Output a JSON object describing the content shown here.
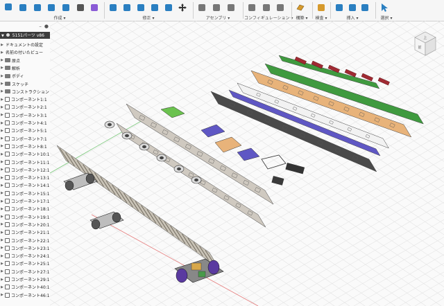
{
  "toolbar": {
    "groups": [
      {
        "label": "作成 ▾",
        "icons": [
          "new-sketch-icon",
          "extrude-icon",
          "box-icon",
          "sketch-rect-icon",
          "polygon-icon",
          "shell-icon"
        ]
      },
      {
        "label": "修正 ▾",
        "icons": [
          "press-pull-icon",
          "fillet-icon",
          "chamfer-icon",
          "split-icon",
          "align-icon",
          "move-icon"
        ]
      },
      {
        "label": "アセンブリ ▾",
        "icons": [
          "new-component-icon",
          "joint-icon",
          "as-built-joint-icon"
        ]
      },
      {
        "label": "コンフィギュレーション ▾",
        "icons": [
          "configure-icon",
          "table-icon",
          "rule-icon"
        ]
      },
      {
        "label": "構築 ▾",
        "icons": [
          "plane-icon"
        ]
      },
      {
        "label": "検査 ▾",
        "icons": [
          "measure-icon"
        ]
      },
      {
        "label": "挿入 ▾",
        "icons": [
          "insert-derive-icon",
          "insert-canvas-icon",
          "insert-image-icon"
        ]
      },
      {
        "label": "選択 ▾",
        "icons": [
          "select-icon"
        ]
      }
    ]
  },
  "browser": {
    "title": "5151パーツ v86",
    "items": [
      {
        "label": "ドキュメントの設定",
        "kind": "setting"
      },
      {
        "label": "名前の付いたビュー",
        "kind": "setting"
      },
      {
        "label": "原点",
        "kind": "folder"
      },
      {
        "label": "解析",
        "kind": "folder"
      },
      {
        "label": "ボディ",
        "kind": "folder"
      },
      {
        "label": "スケッチ",
        "kind": "folder"
      },
      {
        "label": "コンストラクション",
        "kind": "folder"
      },
      {
        "label": "コンポーネント1:1",
        "kind": "comp"
      },
      {
        "label": "コンポーネント2:1",
        "kind": "comp"
      },
      {
        "label": "コンポーネント3:1",
        "kind": "comp"
      },
      {
        "label": "コンポーネント4:1",
        "kind": "comp"
      },
      {
        "label": "コンポーネント5:1",
        "kind": "comp"
      },
      {
        "label": "コンポーネント7:1",
        "kind": "comp"
      },
      {
        "label": "コンポーネント8:1",
        "kind": "comp"
      },
      {
        "label": "コンポーネント10:1",
        "kind": "comp"
      },
      {
        "label": "コンポーネント11:1",
        "kind": "comp"
      },
      {
        "label": "コンポーネント12:1",
        "kind": "comp"
      },
      {
        "label": "コンポーネント13:1",
        "kind": "comp"
      },
      {
        "label": "コンポーネント14:1",
        "kind": "comp"
      },
      {
        "label": "コンポーネント15:1",
        "kind": "comp"
      },
      {
        "label": "コンポーネント17:1",
        "kind": "comp"
      },
      {
        "label": "コンポーネント18:1",
        "kind": "comp"
      },
      {
        "label": "コンポーネント19:1",
        "kind": "comp"
      },
      {
        "label": "コンポーネント20:1",
        "kind": "comp"
      },
      {
        "label": "コンポーネント21:1",
        "kind": "comp"
      },
      {
        "label": "コンポーネント22:1",
        "kind": "comp"
      },
      {
        "label": "コンポーネント23:1",
        "kind": "comp"
      },
      {
        "label": "コンポーネント24:1",
        "kind": "comp"
      },
      {
        "label": "コンポーネント25:1",
        "kind": "comp"
      },
      {
        "label": "コンポーネント27:1",
        "kind": "comp"
      },
      {
        "label": "コンポーネント29:1",
        "kind": "comp"
      },
      {
        "label": "コンポーネント40:1",
        "kind": "comp"
      },
      {
        "label": "コンポーネント46:1",
        "kind": "comp"
      }
    ]
  },
  "viewcube": {
    "top_label": "上",
    "front_label": "前"
  },
  "colors": {
    "grid": "#e4e4e4",
    "body_gray": "#cfc9c0",
    "body_dark": "#4a4a4a",
    "green": "#3f9a3f",
    "red": "#a02a33",
    "orange": "#e8b37a",
    "purple": "#5f57c4"
  }
}
